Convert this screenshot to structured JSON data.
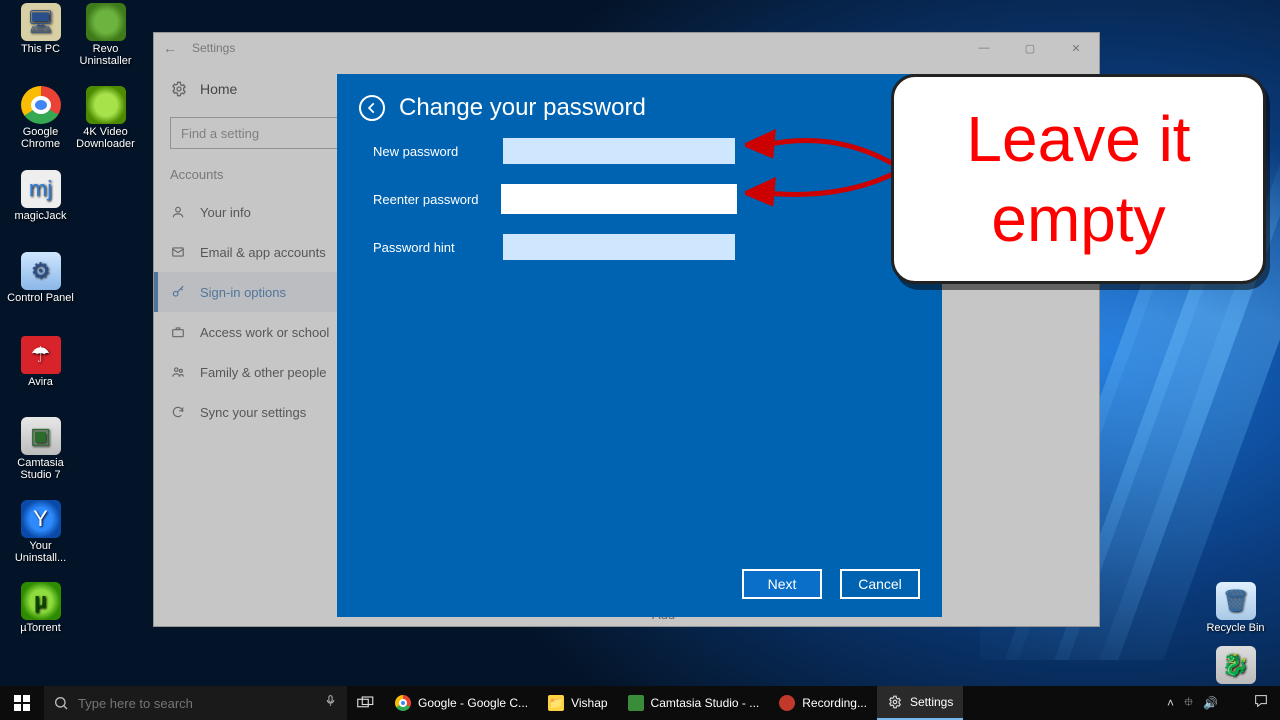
{
  "desktop_icons": {
    "this_pc": "This PC",
    "revo": "Revo Uninstaller",
    "chrome": "Google Chrome",
    "fourk": "4K Video Downloader",
    "magicjack": "magicJack",
    "control_panel": "Control Panel",
    "avira": "Avira",
    "camtasia": "Camtasia Studio 7",
    "your_uninstall": "Your Uninstall...",
    "utorrent": "µTorrent",
    "recycle": "Recycle Bin"
  },
  "settings": {
    "window_title": "Settings",
    "home": "Home",
    "search_placeholder": "Find a setting",
    "section": "Accounts",
    "nav": {
      "info": "Your info",
      "email": "Email & app accounts",
      "signin": "Sign-in options",
      "work": "Access work or school",
      "family": "Family & other people",
      "sync": "Sync your settings"
    },
    "add_button": "Add"
  },
  "modal": {
    "title": "Change your password",
    "new_password": "New password",
    "reenter_password": "Reenter password",
    "password_hint": "Password hint",
    "next": "Next",
    "cancel": "Cancel"
  },
  "callout": "Leave it empty",
  "taskbar": {
    "search_placeholder": "Type here to search",
    "items": {
      "chrome": "Google - Google C...",
      "vishap": "Vishap",
      "camtasia": "Camtasia Studio - ...",
      "recording": "Recording...",
      "settings": "Settings"
    },
    "time": "",
    "tray": [
      "˄",
      "⯐",
      "🔊"
    ]
  }
}
